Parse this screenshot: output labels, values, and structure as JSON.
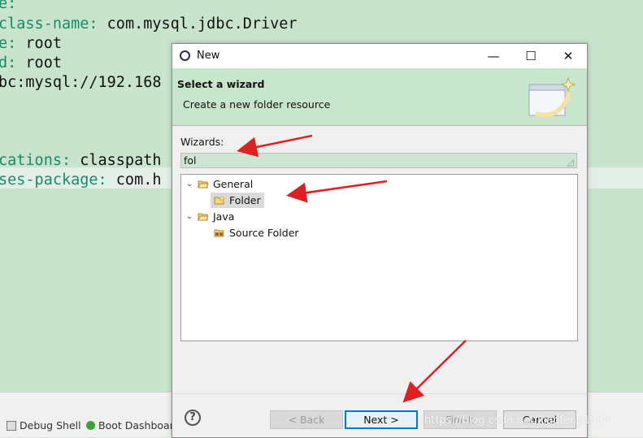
{
  "editor": {
    "lines": [
      {
        "key": "e:",
        "value": ""
      },
      {
        "key": "class-name:",
        "value": " com.mysql.jdbc.Driver"
      },
      {
        "key": "e:",
        "value": " root"
      },
      {
        "key": "d:",
        "value": " root"
      },
      {
        "key": "",
        "value": "bc:mysql://192.168"
      },
      {
        "key": "cations:",
        "value": " classpath"
      },
      {
        "key": "ses-package:",
        "value": " com.h"
      }
    ]
  },
  "bottom_bar": {
    "debug_shell": "Debug Shell",
    "boot_dashboard": "Boot Dashboar"
  },
  "dialog": {
    "title": "New",
    "minimize": "—",
    "maximize": "☐",
    "close": "✕",
    "header_title": "Select a wizard",
    "header_desc": "Create a new folder resource",
    "wizards_label": "Wizards:",
    "filter_value": "fol",
    "tree": {
      "general": "General",
      "folder": "Folder",
      "java": "Java",
      "source_folder": "Source Folder"
    },
    "buttons": {
      "help": "?",
      "back": "< Back",
      "next": "Next >",
      "finish": "Finish",
      "cancel": "Cancel"
    }
  },
  "watermark": "https://blog.csdn.net/xiaofeng1998",
  "colors": {
    "editor_bg": "#c9e4cc",
    "keyword": "#1a8a6a",
    "arrow": "#e02020",
    "default_button_border": "#0078d7"
  }
}
